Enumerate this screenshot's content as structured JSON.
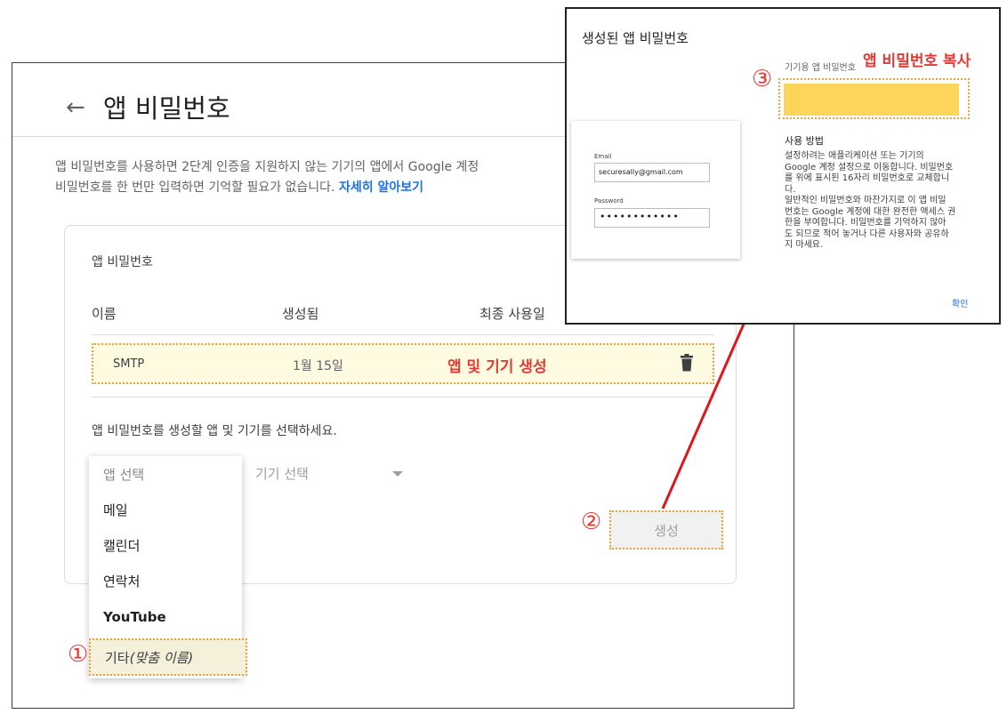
{
  "main": {
    "back_arrow": "←",
    "title": "앱 비밀번호",
    "description": "앱 비밀번호를 사용하면 2단계 인증을 지원하지 않는 기기의 앱에서 Google 계정",
    "description_line2": "비밀번호를 한 번만 입력하면 기억할 필요가 없습니다.",
    "learn_more": "자세히 알아보기",
    "card": {
      "title": "앱 비밀번호",
      "columns": [
        "이름",
        "생성됨",
        "최종 사용일"
      ],
      "row": {
        "name": "SMTP",
        "created": "1월 15일",
        "annotation": "앱 및 기기 생성"
      },
      "select_prompt": "앱 비밀번호를 생성할 앱 및 기기를 선택하세요.",
      "device_select": "기기 선택",
      "generate_label": "생성",
      "step_2": "②"
    },
    "dropdown": {
      "placeholder": "앱 선택",
      "items": [
        "메일",
        "캘린더",
        "연락처",
        "YouTube"
      ],
      "other_prefix": "기타",
      "other_italic": "(맞춤 이름)",
      "step_1": "①"
    }
  },
  "dialog": {
    "title": "생성된 앱 비밀번호",
    "email_label": "Email",
    "email_value": "securesally@gmail.com",
    "password_label": "Password",
    "password_value": "••••••••••••",
    "device_pw_label": "기기용 앱 비밀번호",
    "copy_annotation": "앱 비밀번호 복사",
    "step_3": "③",
    "usage_heading": "사용 방법",
    "usage_text": "설정하려는 애플리케이션 또는 기기의\nGoogle 계정 설정으로 이동합니다. 비밀번호\n를 위에 표시된 16자리 비밀번호로 교체합니\n다.\n일반적인 비밀번호와 마찬가지로 이 앱 비밀\n번호는 Google 계정에 대한 완전한 액세스 권\n한을 부여합니다. 비밀번호를 기억하지 않아\n도 되므로 적어 놓거나 다른 사용자와 공유하\n지 마세요.",
    "ok_label": "확인"
  },
  "colors": {
    "annotation_red": "#e53935",
    "highlight_border": "#e8a33d",
    "password_fill": "#fdd55a",
    "link_blue": "#1a73e8"
  }
}
